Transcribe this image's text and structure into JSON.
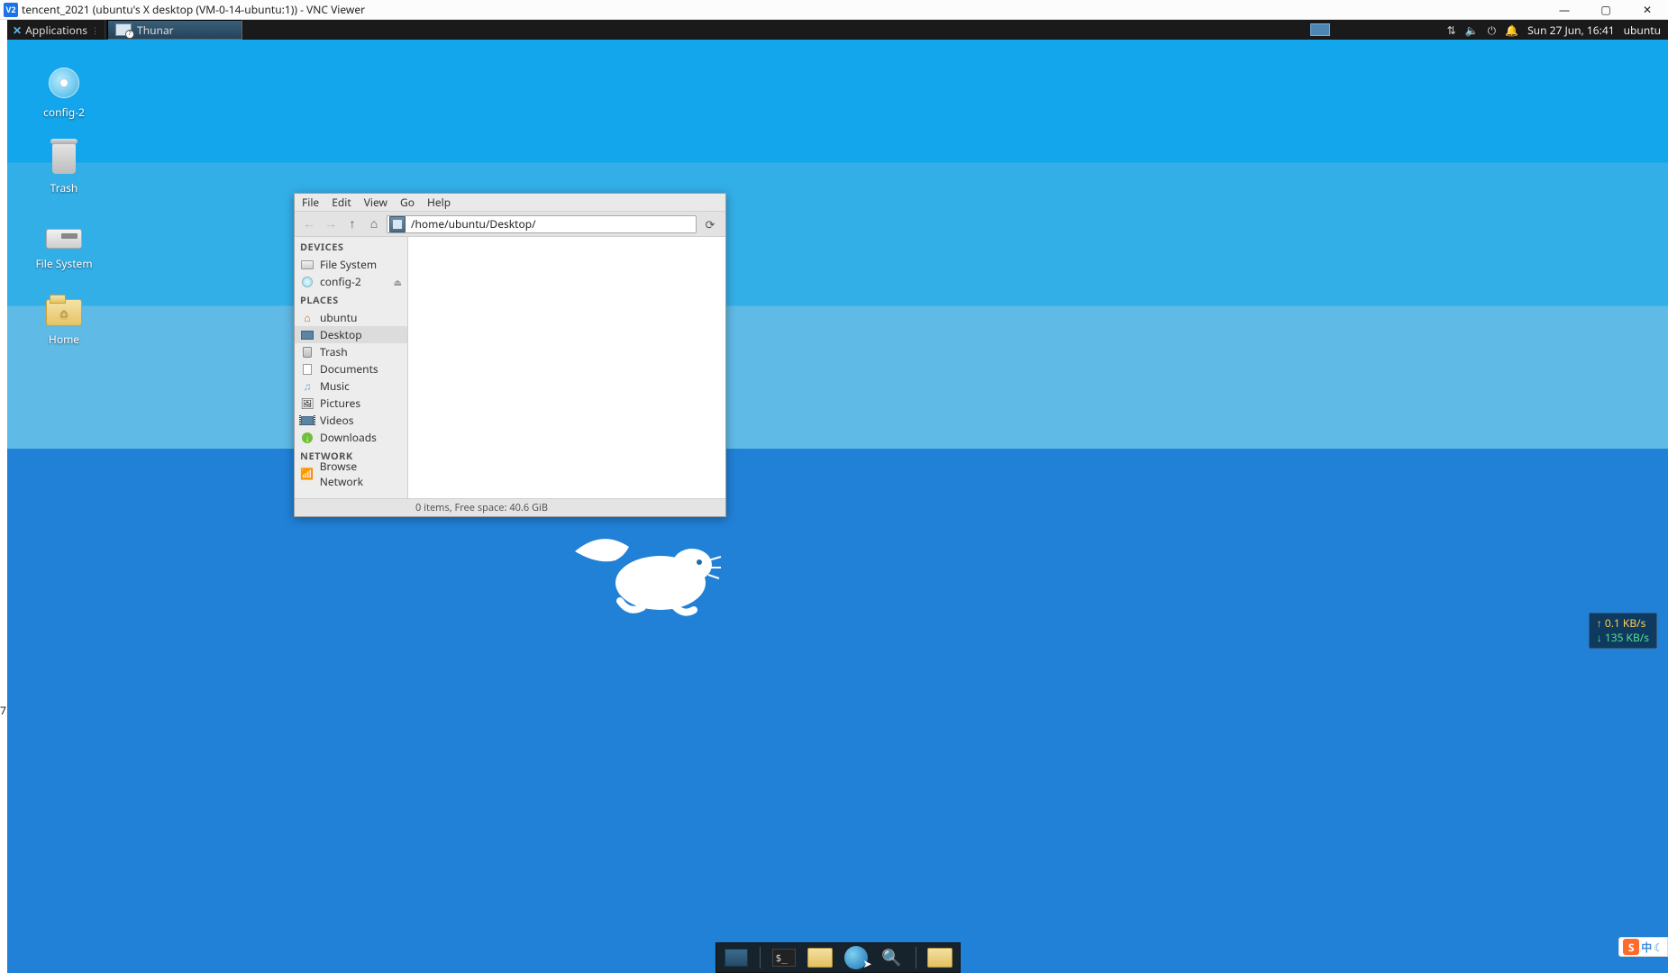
{
  "vnc": {
    "logo": "V2",
    "title": "tencent_2021 (ubuntu's X desktop (VM-0-14-ubuntu:1)) - VNC Viewer",
    "min": "—",
    "max": "▢",
    "close": "✕"
  },
  "panel": {
    "applications": "Applications",
    "task_app": "Thunar",
    "clock": "Sun 27 Jun, 16:41",
    "user": "ubuntu"
  },
  "desktop_icons": {
    "config": "config-2",
    "trash": "Trash",
    "filesystem": "File System",
    "home": "Home"
  },
  "thunar": {
    "menus": {
      "file": "File",
      "edit": "Edit",
      "view": "View",
      "go": "Go",
      "help": "Help"
    },
    "path": "/home/ubuntu/Desktop/",
    "headers": {
      "devices": "DEVICES",
      "places": "PLACES",
      "network": "NETWORK"
    },
    "devices": {
      "filesystem": "File System",
      "config": "config-2"
    },
    "places": {
      "ubuntu": "ubuntu",
      "desktop": "Desktop",
      "trash": "Trash",
      "documents": "Documents",
      "music": "Music",
      "pictures": "Pictures",
      "videos": "Videos",
      "downloads": "Downloads"
    },
    "network": {
      "browse": "Browse Network"
    },
    "status": "0 items, Free space: 40.6 GiB"
  },
  "netspeed": {
    "up": "↑ 0.1 KB/s",
    "down": "↓ 135 KB/s"
  },
  "ime": {
    "s": "S",
    "zh": "中",
    "moon": "☾"
  },
  "side_num": "7"
}
